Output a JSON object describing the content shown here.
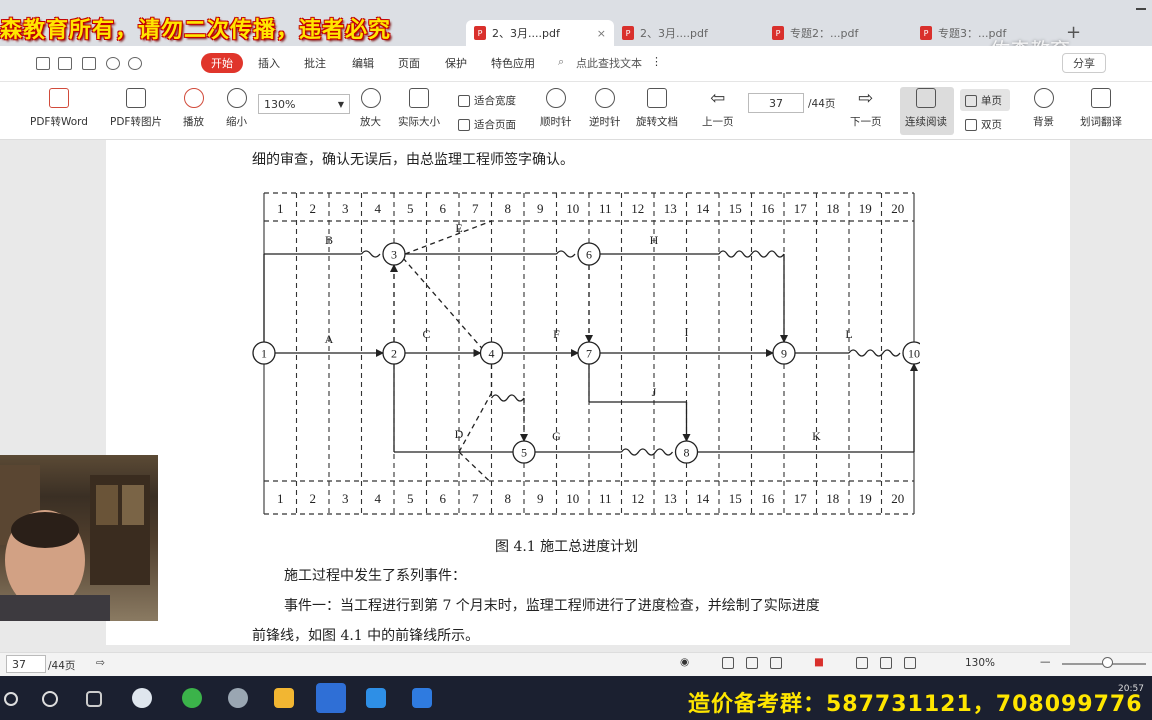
{
  "window": {
    "watermark_title": "森教育所有，请勿二次传播，违者必究",
    "brand_watermark": "佑森教育",
    "new_tab": "+",
    "tabs": [
      {
        "label": "2、3月....pdf",
        "close": "×",
        "active": true
      },
      {
        "label": "2、3月....pdf",
        "active": false
      },
      {
        "label": "专题2：...pdf",
        "active": false
      },
      {
        "label": "专题3：...pdf",
        "active": false
      }
    ]
  },
  "menu": {
    "items": [
      "开始",
      "插入",
      "批注",
      "编辑",
      "页面",
      "保护",
      "特色应用"
    ],
    "search_placeholder": "点此查找文本",
    "share": "分享",
    "more": "⋮"
  },
  "toolbar": {
    "tools": [
      "PDF转Word",
      "PDF转图片",
      "播放",
      "缩小",
      "放大",
      "实际大小",
      "顺时针",
      "逆时针",
      "旋转文档",
      "上一页",
      "下一页",
      "连续阅读",
      "背景",
      "划词翻译"
    ],
    "zoom_value": "130%",
    "fit_width": "适合宽度",
    "fit_page": "适合页面",
    "page_input": "37",
    "page_total": "/44页",
    "single_page": "单页",
    "double_page": "双页"
  },
  "document": {
    "line_top": "细的审查，确认无误后，由总监理工程师签字确认。",
    "caption": "图 4.1   施工总进度计划",
    "para1": "施工过程中发生了系列事件：",
    "para2": "事件一：当工程进行到第 7 个月末时，监理工程师进行了进度检查，并绘制了实际进度",
    "para3": "前锋线，如图 4.1 中的前锋线所示。",
    "diagram": {
      "months": [
        "1",
        "2",
        "3",
        "4",
        "5",
        "6",
        "7",
        "8",
        "9",
        "10",
        "11",
        "12",
        "13",
        "14",
        "15",
        "16",
        "17",
        "18",
        "19",
        "20"
      ],
      "nodes": [
        "1",
        "2",
        "3",
        "4",
        "5",
        "6",
        "7",
        "8",
        "9",
        "10"
      ],
      "activities": [
        "A",
        "B",
        "C",
        "D",
        "E",
        "F",
        "G",
        "H",
        "I",
        "J",
        "K",
        "L"
      ]
    }
  },
  "statusbar": {
    "page_input": "37",
    "page_total": "/44页",
    "zoom": "130%",
    "minus": "—",
    "plus": "+"
  },
  "taskbar": {
    "banner": "造价备考群：587731121，708099776",
    "clock": "20:57"
  },
  "colors": {
    "accent": "#e0352b",
    "banner": "#ffe600",
    "taskbar": "#1b2030"
  }
}
